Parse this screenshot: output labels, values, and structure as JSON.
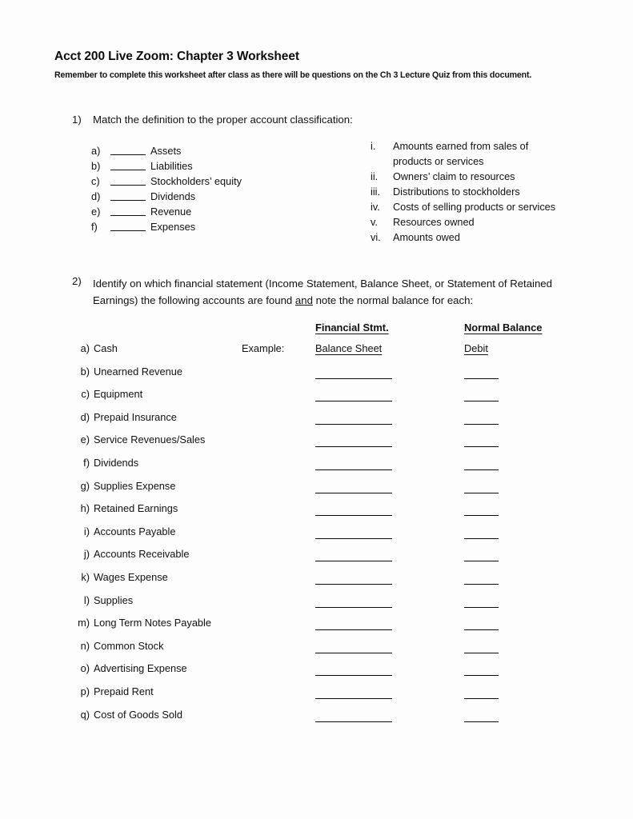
{
  "document": {
    "title": "Acct 200 Live Zoom: Chapter 3 Worksheet",
    "subtitle": "Remember to complete this worksheet after class as there will be questions on the Ch 3 Lecture Quiz from this document."
  },
  "question1": {
    "number": "1)",
    "prompt": "Match the definition to the proper account classification:",
    "items": [
      {
        "letter": "a)",
        "label": "Assets"
      },
      {
        "letter": "b)",
        "label": "Liabilities"
      },
      {
        "letter": "c)",
        "label": "Stockholders’ equity"
      },
      {
        "letter": "d)",
        "label": "Dividends"
      },
      {
        "letter": "e)",
        "label": "Revenue"
      },
      {
        "letter": "f)",
        "label": "Expenses"
      }
    ],
    "definitions": [
      {
        "numeral": "i.",
        "text": "Amounts earned from sales of products or services"
      },
      {
        "numeral": "ii.",
        "text": "Owners’ claim to resources"
      },
      {
        "numeral": "iii.",
        "text": "Distributions to stockholders"
      },
      {
        "numeral": "iv.",
        "text": "Costs of selling products or services"
      },
      {
        "numeral": "v.",
        "text": "Resources owned"
      },
      {
        "numeral": "vi.",
        "text": "Amounts owed"
      }
    ]
  },
  "question2": {
    "number": "2)",
    "prompt_part1": "Identify on which financial statement (Income Statement, Balance Sheet, or Statement of Retained Earnings) the following accounts are found ",
    "prompt_emphasis": "and",
    "prompt_part2": " note the normal balance for each:",
    "columns": {
      "financial_statement": "Financial Stmt.",
      "normal_balance": "Normal Balance"
    },
    "example_label": "Example:",
    "rows": [
      {
        "letter": "a)",
        "account": "Cash",
        "example": "Example:",
        "financial_statement": "Balance Sheet",
        "normal_balance": "Debit",
        "filled": true
      },
      {
        "letter": "b)",
        "account": "Unearned Revenue",
        "financial_statement": "",
        "normal_balance": "",
        "filled": false
      },
      {
        "letter": "c)",
        "account": "Equipment",
        "financial_statement": "",
        "normal_balance": "",
        "filled": false
      },
      {
        "letter": "d)",
        "account": "Prepaid Insurance",
        "financial_statement": "",
        "normal_balance": "",
        "filled": false
      },
      {
        "letter": "e)",
        "account": "Service Revenues/Sales",
        "financial_statement": "",
        "normal_balance": "",
        "filled": false
      },
      {
        "letter": "f)",
        "account": "Dividends",
        "financial_statement": "",
        "normal_balance": "",
        "filled": false
      },
      {
        "letter": "g)",
        "account": "Supplies Expense",
        "financial_statement": "",
        "normal_balance": "",
        "filled": false
      },
      {
        "letter": "h)",
        "account": "Retained Earnings",
        "financial_statement": "",
        "normal_balance": "",
        "filled": false
      },
      {
        "letter": "i)",
        "account": "Accounts Payable",
        "financial_statement": "",
        "normal_balance": "",
        "filled": false
      },
      {
        "letter": "j)",
        "account": "Accounts Receivable",
        "financial_statement": "",
        "normal_balance": "",
        "filled": false
      },
      {
        "letter": "k)",
        "account": "Wages Expense",
        "financial_statement": "",
        "normal_balance": "",
        "filled": false
      },
      {
        "letter": "l)",
        "account": "Supplies",
        "financial_statement": "",
        "normal_balance": "",
        "filled": false
      },
      {
        "letter": "m)",
        "account": "Long Term Notes Payable",
        "financial_statement": "",
        "normal_balance": "",
        "filled": false
      },
      {
        "letter": "n)",
        "account": "Common Stock",
        "financial_statement": "",
        "normal_balance": "",
        "filled": false
      },
      {
        "letter": "o)",
        "account": "Advertising Expense",
        "financial_statement": "",
        "normal_balance": "",
        "filled": false
      },
      {
        "letter": "p)",
        "account": "Prepaid Rent",
        "financial_statement": "",
        "normal_balance": "",
        "filled": false
      },
      {
        "letter": "q)",
        "account": "Cost of Goods Sold",
        "financial_statement": "",
        "normal_balance": "",
        "filled": false
      }
    ]
  }
}
